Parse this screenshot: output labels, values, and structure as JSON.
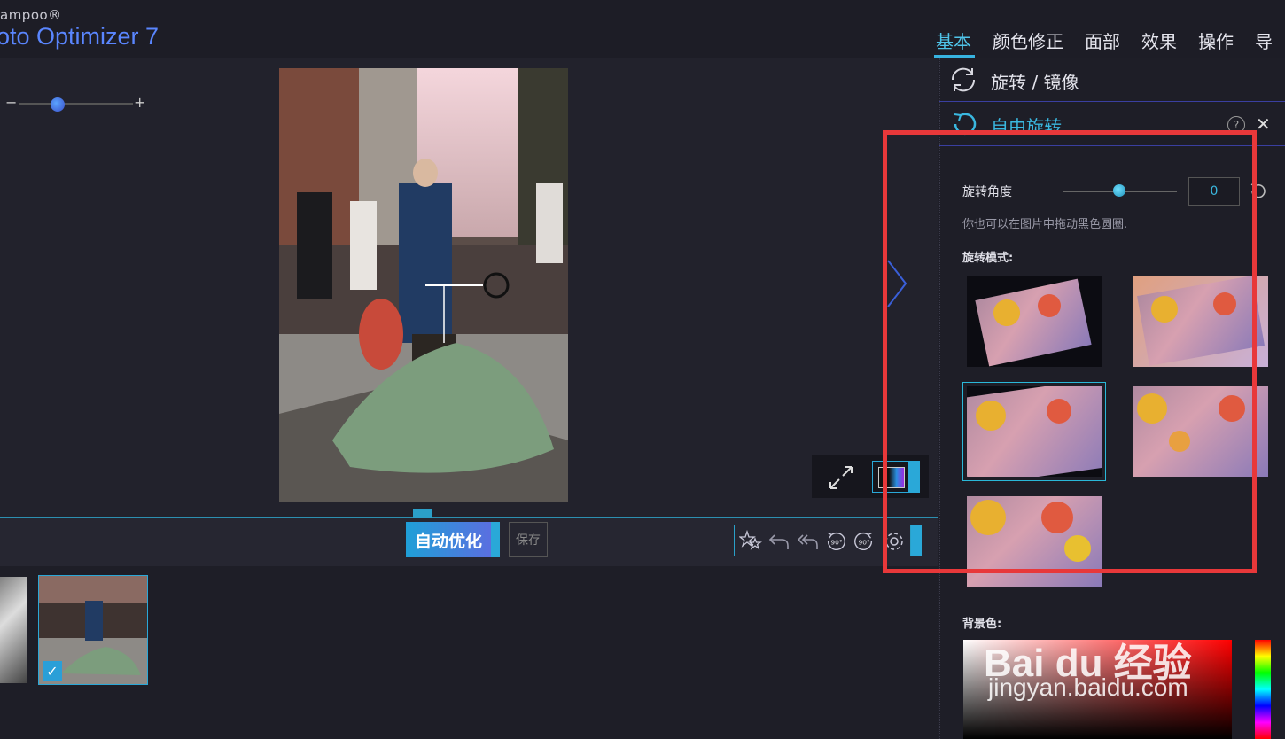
{
  "app": {
    "brand_small": "ampoo®",
    "brand_title": "oto Optimizer 7"
  },
  "menu": [
    "基本",
    "颜色修正",
    "面部",
    "效果",
    "操作",
    "导出"
  ],
  "canvas": {
    "zoom_minus": "−",
    "zoom_plus": "+"
  },
  "toolbar": {
    "auto_optimize": "自动优化",
    "save": "保存",
    "rotate_left_90": "90°",
    "rotate_right_90": "90°"
  },
  "panel": {
    "section_rotate_mirror": "旋转 / 镜像",
    "section_free_rotate": "自由旋转",
    "help": "?",
    "close": "✕",
    "angle_label": "旋转角度",
    "angle_value": "0",
    "hint": "你也可以在图片中拖动黑色圆圈.",
    "mode_label": "旋转模式:",
    "bg_label": "背景色:"
  },
  "watermark": {
    "line1": "Bai du 经验",
    "line2": "jingyan.baidu.com"
  },
  "colors": {
    "accent": "#2ab8d8",
    "highlight": "#e8383a",
    "brand": "#5a86ff"
  }
}
